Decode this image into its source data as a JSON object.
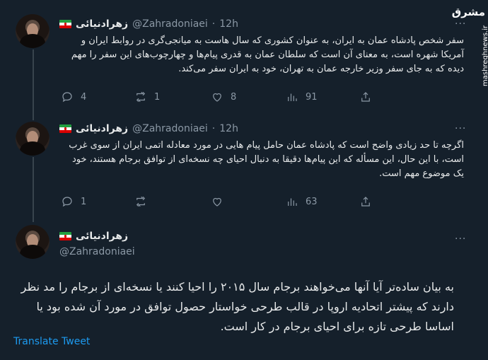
{
  "colors": {
    "background": "#15202b",
    "text": "#e7e9ea",
    "muted": "#8b98a5",
    "link": "#1d9bf0",
    "divider": "#38444d"
  },
  "watermark": {
    "logo": "مشرق",
    "url": "mashreghnews.ir"
  },
  "tweets": [
    {
      "author": {
        "name": "زهرادنیائی",
        "handle": "@Zahradoniaei"
      },
      "separator": "·",
      "time": "12h",
      "text": "سفر شخص پادشاه عمان به ایران، به عنوان کشوری که سال هاست به میانجی‌گری در روابط ایران و آمریکا شهره است، به معنای آن است که سلطان عمان به قدری پیام‌ها و چهارچوب‌های این سفر را مهم دیده که به جای سفر وزیر خارجه عمان به تهران، خود به ایران سفر می‌کند.",
      "replies": "4",
      "retweets": "1",
      "likes": "8",
      "views": "91"
    },
    {
      "author": {
        "name": "زهرادنیائی",
        "handle": "@Zahradoniaei"
      },
      "separator": "·",
      "time": "12h",
      "text": "اگرچه تا حد زیادی واضح است که پادشاه عمان حامل پیام هایی در مورد معادله اتمی ایران از سوی غرب است، با این حال، این مسأله که این پیام‌ها دقیقا به دنبال احیای چه نسخه‌ای از توافق برجام هستند، خود یک موضوع مهم است.",
      "replies": "1",
      "retweets": "",
      "likes": "",
      "views": "63"
    },
    {
      "author": {
        "name": "زهرادنیائی",
        "handle": "@Zahradoniaei"
      },
      "text": "به بیان ساده‌تر آیا آنها می‌خواهند برجام سال ۲۰۱۵ را احیا کنند یا نسخه‌ای از برجام را مد نظر دارند که پیشتر اتحادیه اروپا در قالب طرحی خواستار حصول توافق در مورد آن شده بود  یا اساسا طرحی تازه برای احیای برجام در کار است.",
      "translate": "Translate Tweet"
    }
  ],
  "icons": {
    "reply": "reply-icon",
    "retweet": "retweet-icon",
    "like": "heart-icon",
    "views": "views-icon",
    "share": "share-icon",
    "more": "more-icon"
  },
  "more_label": "···"
}
